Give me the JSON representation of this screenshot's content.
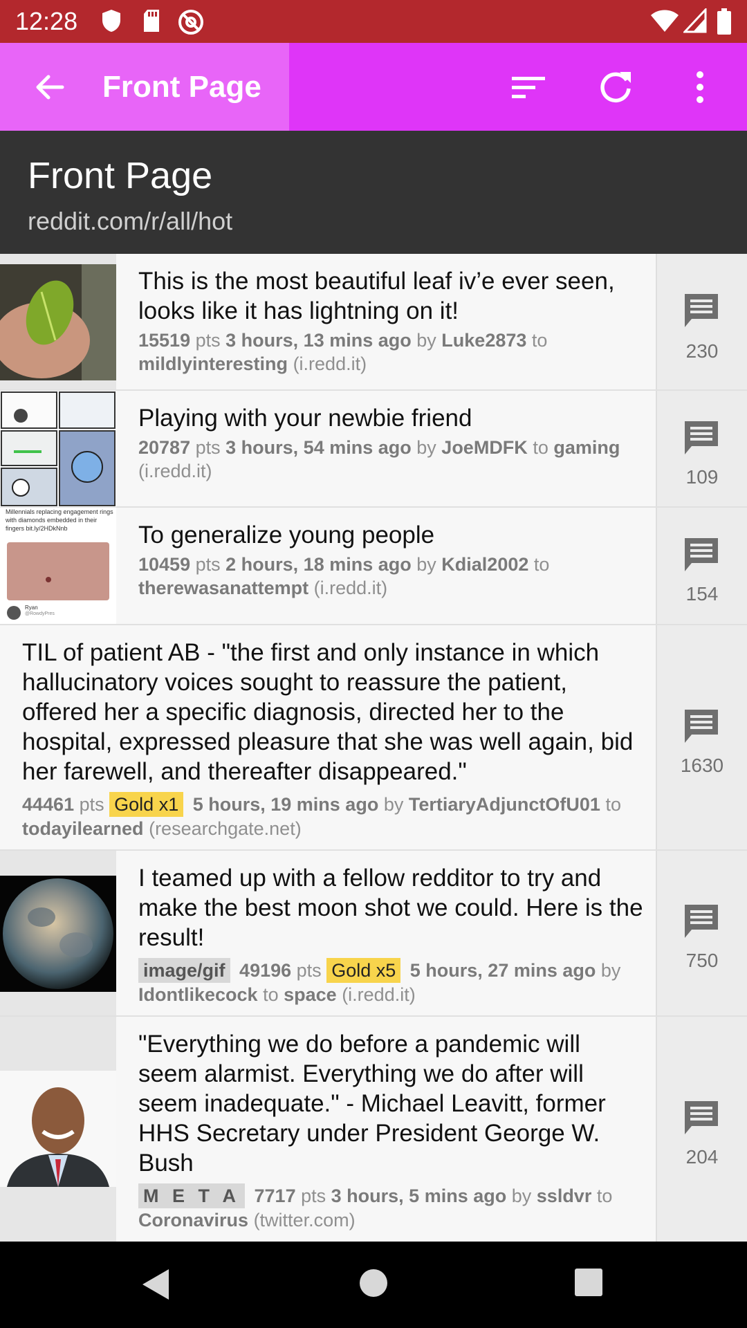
{
  "status_bar": {
    "time": "12:28",
    "left_icons": [
      "shield-icon",
      "sd-card-icon",
      "at-sign-icon"
    ],
    "right_icons": [
      "wifi-icon",
      "signal-icon",
      "battery-icon"
    ]
  },
  "app_bar": {
    "title": "Front Page",
    "actions": [
      "sort-icon",
      "refresh-icon",
      "more-vert-icon"
    ],
    "color": "#df35f8",
    "title_bg": "#e865f8"
  },
  "header": {
    "title": "Front Page",
    "subtitle": "reddit.com/r/all/hot"
  },
  "posts": [
    {
      "title": "This is the most beautiful leaf iv’e ever seen, looks like it has lightning on it!",
      "points": "15519",
      "pts_label": "pts",
      "time": "3 hours, 13 mins ago",
      "by_label": "by",
      "author": "Luke2873",
      "to_label": "to",
      "subreddit": "mildlyinteresting",
      "domain": "(i.redd.it)",
      "comments": "230"
    },
    {
      "title": "Playing with your newbie friend",
      "points": "20787",
      "pts_label": "pts",
      "time": "3 hours, 54 mins ago",
      "by_label": "by",
      "author": "JoeMDFK",
      "to_label": "to",
      "subreddit": "gaming",
      "domain": "(i.redd.it)",
      "comments": "109"
    },
    {
      "title": "To generalize young people",
      "points": "10459",
      "pts_label": "pts",
      "time": "2 hours, 18 mins ago",
      "by_label": "by",
      "author": "Kdial2002",
      "to_label": "to",
      "subreddit": "therewasanattempt",
      "domain": "(i.redd.it)",
      "comments": "154",
      "thumb_text": "Millennials replacing engagement rings with diamonds embedded in their fingers bit.ly/2HDkNnb",
      "thumb_user": "Ryan",
      "thumb_handle": "@RowdyPres"
    },
    {
      "title": "TIL of patient AB - \"the first and only instance in which hallucinatory voices sought to reassure the patient, offered her a specific diagnosis, directed her to the hospital, expressed pleasure that she was well again, bid her farewell, and thereafter disappeared.\"",
      "points": "44461",
      "pts_label": "pts",
      "gold": "Gold x1",
      "time": "5 hours, 19 mins ago",
      "by_label": "by",
      "author": "TertiaryAdjunctOfU01",
      "to_label": "to",
      "subreddit": "todayilearned",
      "domain": "(researchgate.net)",
      "comments": "1630"
    },
    {
      "title": "I teamed up with a fellow redditor to try and make the best moon shot we could. Here is the result!",
      "flair": "image/gif",
      "points": "49196",
      "pts_label": "pts",
      "gold": "Gold x5",
      "time": "5 hours, 27 mins ago",
      "by_label": "by",
      "author": "Idontlikecock",
      "to_label": "to",
      "subreddit": "space",
      "domain": "(i.redd.it)",
      "comments": "750"
    },
    {
      "title": "\"Everything we do before a pandemic will seem alarmist. Everything we do after will seem inadequate.\" - Michael Leavitt, former HHS Secretary under President George W. Bush",
      "flair": "M E T A",
      "points": "7717",
      "pts_label": "pts",
      "time": "3 hours, 5 mins ago",
      "by_label": "by",
      "author": "ssldvr",
      "to_label": "to",
      "subreddit": "Coronavirus",
      "domain": "(twitter.com)",
      "comments": "204"
    }
  ],
  "nav_bar": {
    "icons": [
      "back-nav-icon",
      "home-nav-icon",
      "recents-nav-icon"
    ]
  }
}
